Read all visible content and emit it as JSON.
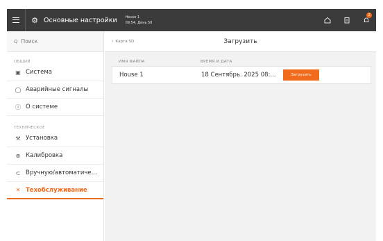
{
  "topbar": {
    "title": "Основные настройки",
    "house_name": "House 1",
    "house_time": "09:54, День 50",
    "notification_count": "2"
  },
  "sidebar": {
    "search_placeholder": "Поиск",
    "section_general": "ОБЩИЙ",
    "section_technical": "ТЕХНИЧЕСКОЕ",
    "items_general": [
      {
        "label": "Система",
        "icon": "system-icon"
      },
      {
        "label": "Аварийные сигналы",
        "icon": "alarm-icon"
      },
      {
        "label": "О системе",
        "icon": "info-icon"
      }
    ],
    "items_technical": [
      {
        "label": "Установка",
        "icon": "installation-icon"
      },
      {
        "label": "Калибровка",
        "icon": "calibration-icon"
      },
      {
        "label": "Вручную/автоматиче...",
        "icon": "manual-auto-icon"
      },
      {
        "label": "Техобслуживание",
        "icon": "wrench-icon",
        "active": true
      }
    ]
  },
  "main": {
    "back_label": "Карта SD",
    "title": "Загрузить",
    "columns": {
      "file_name": "ИМЯ ФАЙЛА",
      "date_time": "ВРЕМЯ И ДАТА"
    },
    "rows": [
      {
        "file_name": "House 1",
        "date_time": "18 Сентябрь. 2025 08:...",
        "action": "Загрузить"
      }
    ]
  },
  "colors": {
    "accent": "#f26a1b",
    "topbar": "#3b3b3b",
    "main_bg": "#f2f2f2"
  }
}
